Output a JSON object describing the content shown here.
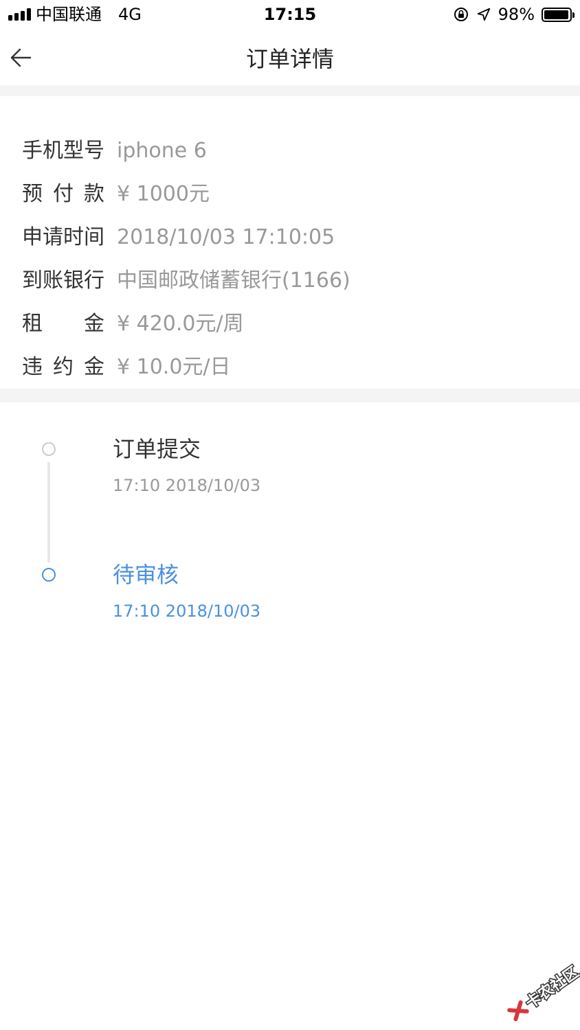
{
  "status_bar": {
    "carrier": "中国联通",
    "network": "4G",
    "time": "17:15",
    "battery_percent": "98%",
    "battery_level": 0.98,
    "icons": [
      "signal-icon",
      "rotation-lock-icon",
      "location-arrow-icon",
      "battery-icon"
    ]
  },
  "nav": {
    "title": "订单详情",
    "back_icon": "back-arrow-icon"
  },
  "info": {
    "rows": [
      {
        "label": "手机型号",
        "value": "iphone 6"
      },
      {
        "label": "预付款",
        "value": "¥ 1000元"
      },
      {
        "label": "申请时间",
        "value": "2018/10/03 17:10:05"
      },
      {
        "label": "到账银行",
        "value": "中国邮政储蓄银行(1166)"
      },
      {
        "label": "租金",
        "value": "¥ 420.0元/周"
      },
      {
        "label": "违约金",
        "value": "¥ 10.0元/日"
      }
    ]
  },
  "timeline": {
    "steps": [
      {
        "title": "订单提交",
        "time": "17:10 2018/10/03",
        "state": "done"
      },
      {
        "title": "待审核",
        "time": "17:10 2018/10/03",
        "state": "current"
      }
    ]
  },
  "colors": {
    "accent": "#4a90e2",
    "label": "#333333",
    "value": "#999999",
    "band": "#f4f4f4"
  },
  "watermark": {
    "text": "卡农社区"
  }
}
